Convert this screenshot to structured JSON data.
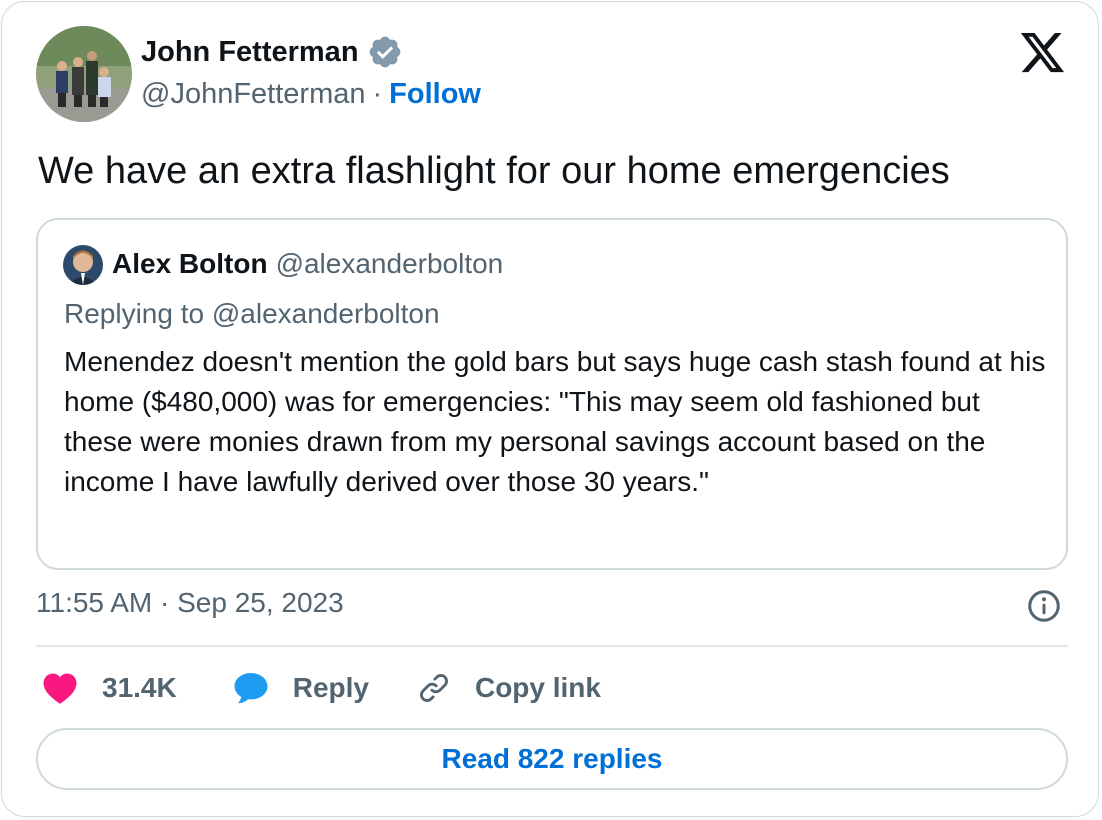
{
  "author": {
    "name": "John Fetterman",
    "handle": "@JohnFetterman",
    "separator": "·",
    "follow_label": "Follow",
    "verified_icon": "verified-badge-icon"
  },
  "brand_logo": "x-logo-icon",
  "tweet": {
    "text": "We have an extra flashlight for our home emergencies"
  },
  "quoted_tweet": {
    "author_name": "Alex Bolton",
    "author_handle": "@alexanderbolton",
    "replying_to": "Replying to @alexanderbolton",
    "body": "Menendez doesn't mention the gold bars but says huge cash stash found at his home ($480,000) was for emergencies: \"This may seem old fashioned but these were monies drawn from my personal savings account based on the income I have lawfully derived over those 30 years.\""
  },
  "meta": {
    "timestamp": "11:55 AM · Sep 25, 2023",
    "info_icon": "info-icon"
  },
  "actions": {
    "like_count": "31.4K",
    "reply_label": "Reply",
    "copy_link_label": "Copy link"
  },
  "read_replies_label": "Read 822 replies",
  "colors": {
    "link_blue": "#006fd6",
    "like_pink": "#f91880",
    "reply_blue": "#1d9bf0",
    "secondary_text": "#536471",
    "border": "#cfd9de"
  }
}
